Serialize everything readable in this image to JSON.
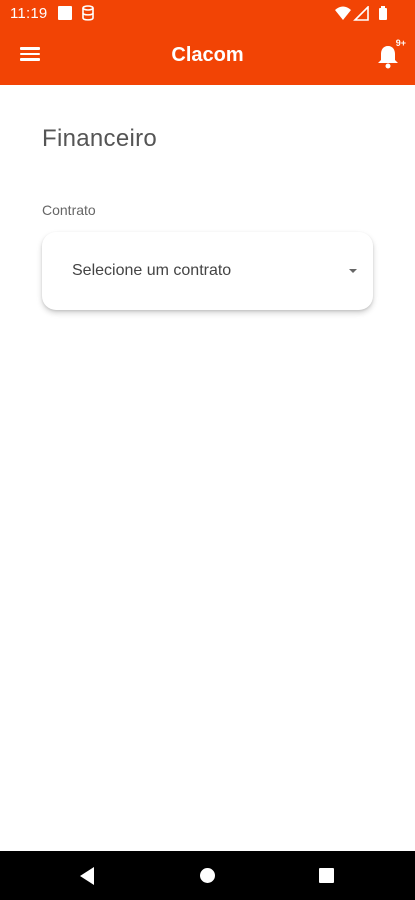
{
  "status_bar": {
    "time": "11:19",
    "icons": [
      "notification-square-icon",
      "database-icon",
      "wifi-icon",
      "signal-icon",
      "battery-icon"
    ]
  },
  "app_bar": {
    "title": "Clacom",
    "menu_icon": "menu-icon",
    "notification_icon": "bell-icon",
    "notification_badge": "9+"
  },
  "page": {
    "title": "Financeiro",
    "contract_label": "Contrato",
    "contract_select": {
      "placeholder": "Selecione um contrato",
      "icon": "caret-down-icon"
    }
  },
  "nav_bar": {
    "icons": [
      "back-icon",
      "home-icon",
      "recents-icon"
    ]
  },
  "colors": {
    "primary": "#f24405",
    "background": "#ffffff",
    "nav_background": "#000000"
  }
}
